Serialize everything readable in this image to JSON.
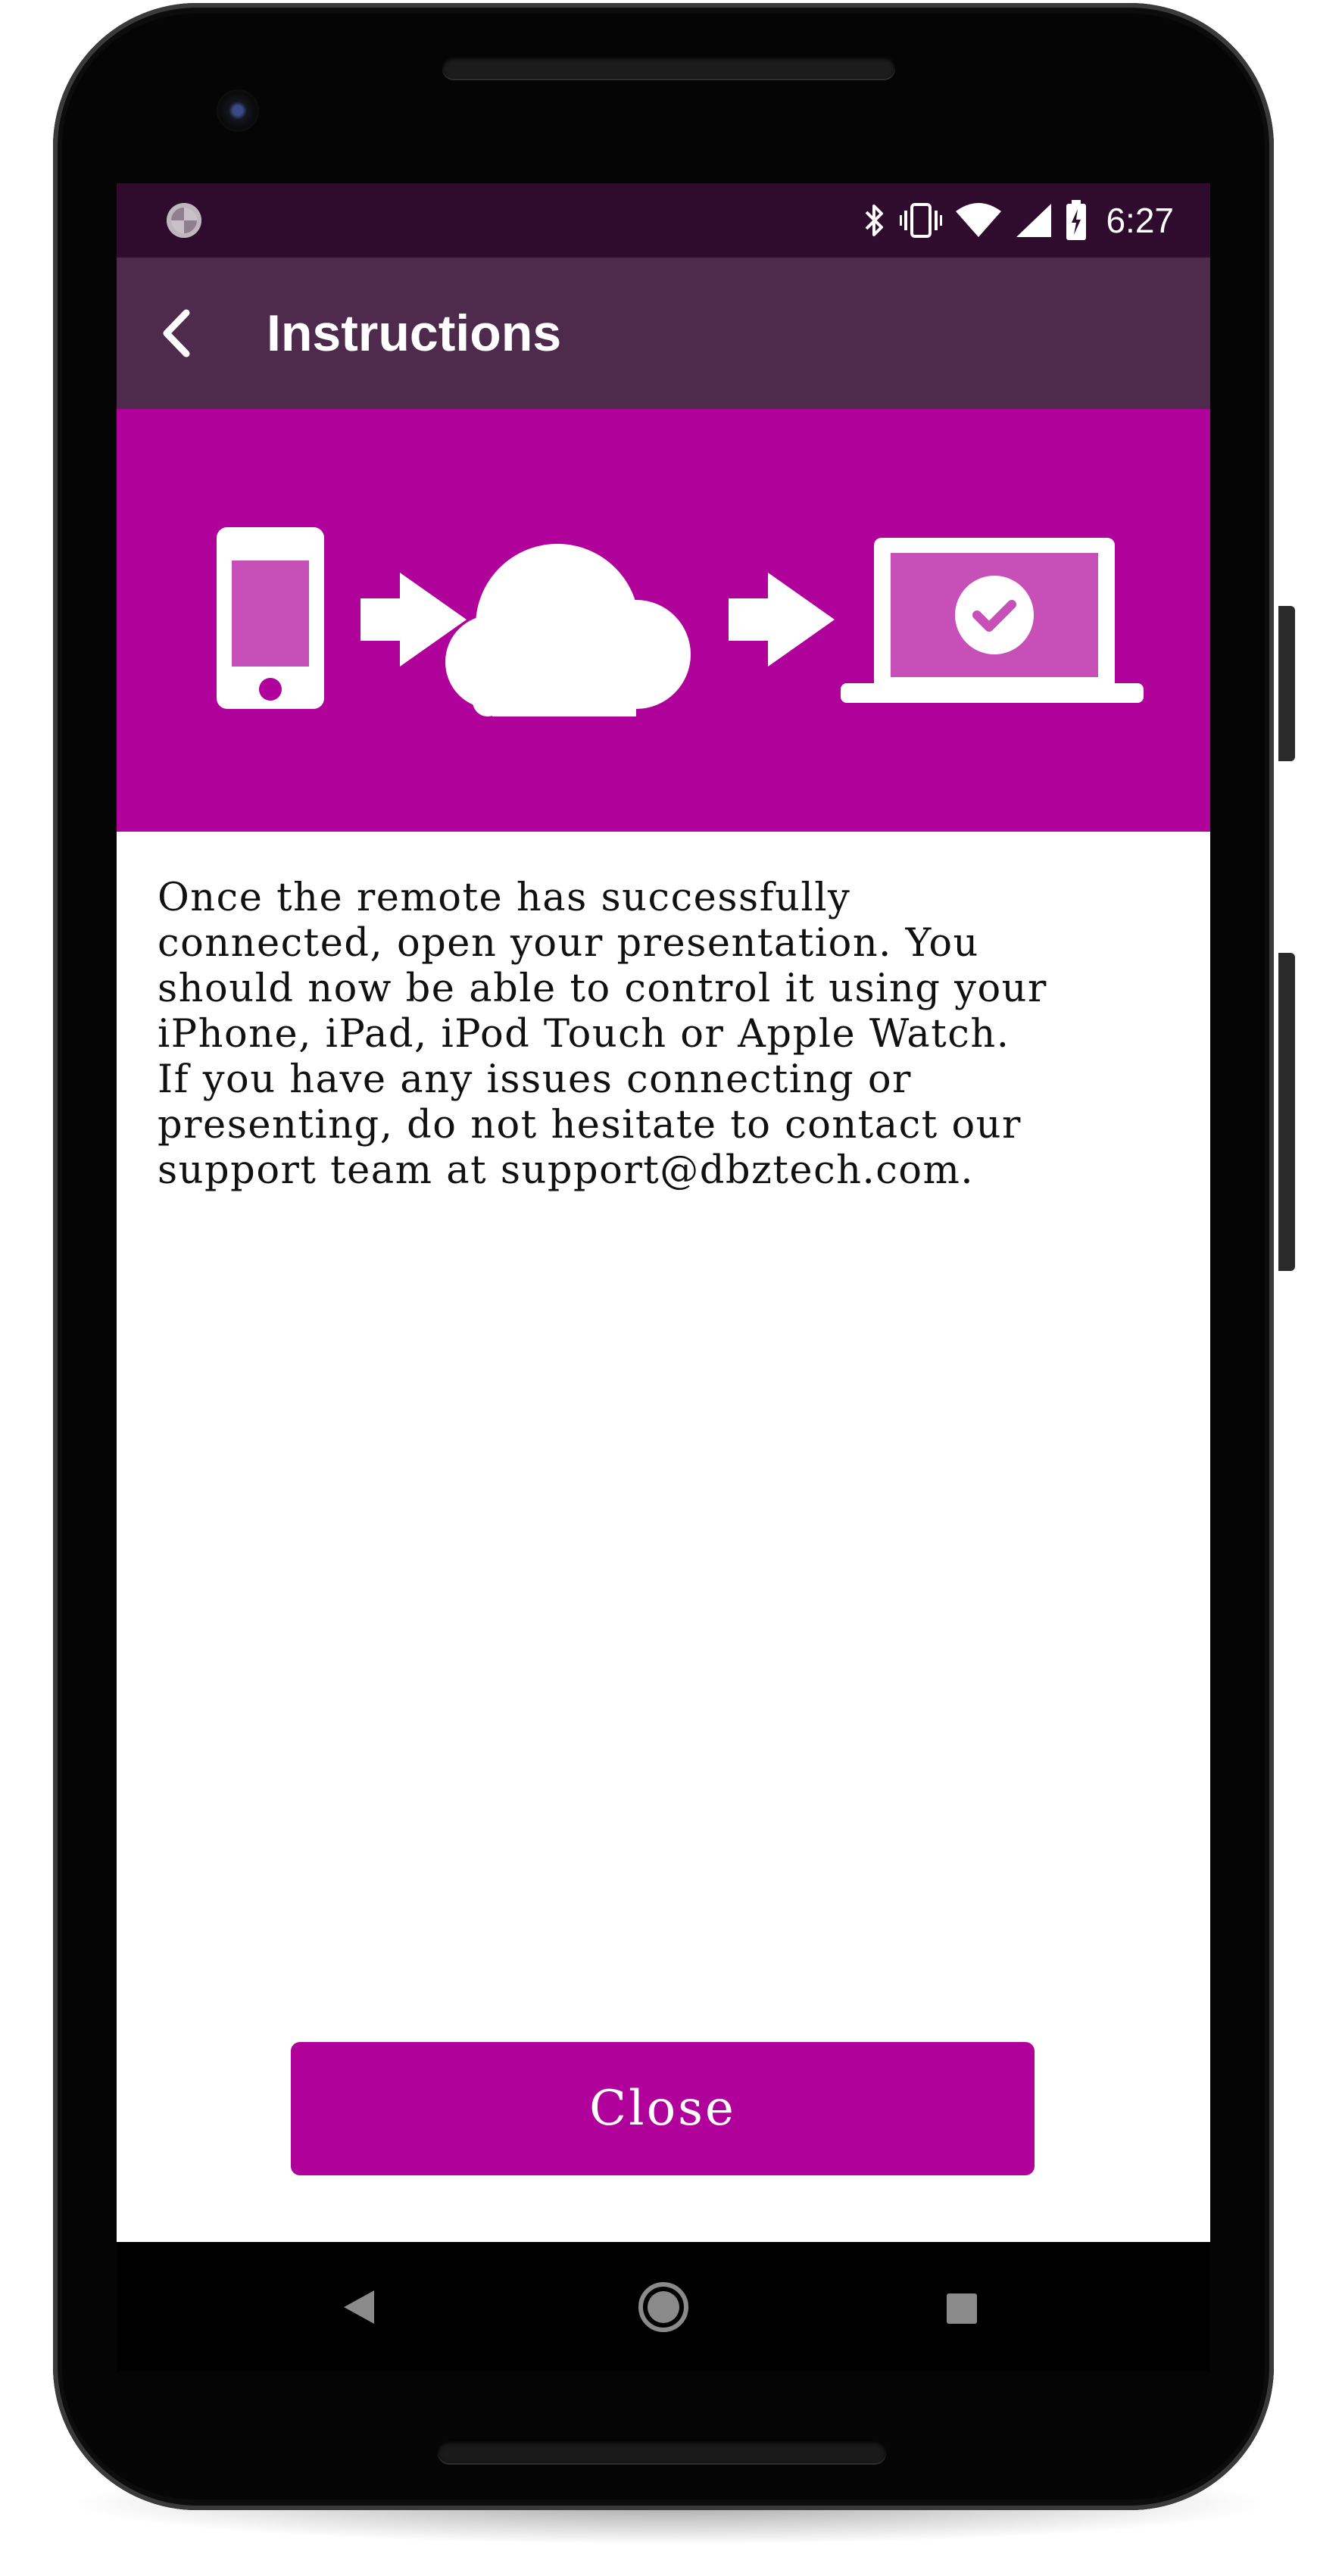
{
  "status_bar": {
    "time": "6:27",
    "icons": [
      "sync-icon",
      "bluetooth-icon",
      "vibrate-icon",
      "wifi-icon",
      "signal-icon",
      "battery-charging-icon"
    ]
  },
  "app_bar": {
    "title": "Instructions",
    "back_icon": "chevron-left-icon"
  },
  "hero": {
    "background": "#b0029a",
    "icons": [
      "phone-icon",
      "arrow-right-icon",
      "cloud-icon",
      "arrow-right-icon",
      "laptop-check-icon"
    ]
  },
  "body": {
    "text_lines": [
      "Once the remote has successfully",
      "connected, open your presentation. You",
      "should now be able to control it using your",
      "iPhone, iPad, iPod Touch or Apple Watch.",
      "If you have any issues connecting or",
      "presenting, do not hesitate to contact our",
      "support team at support@dbztech.com."
    ]
  },
  "close_button": {
    "label": "Close"
  },
  "nav_bar": {
    "icons": [
      "nav-back-icon",
      "nav-home-icon",
      "nav-recent-icon"
    ]
  },
  "colors": {
    "accent": "#b0029a",
    "app_bar": "#4e2a4d",
    "status_bar": "#2f0b2e"
  }
}
